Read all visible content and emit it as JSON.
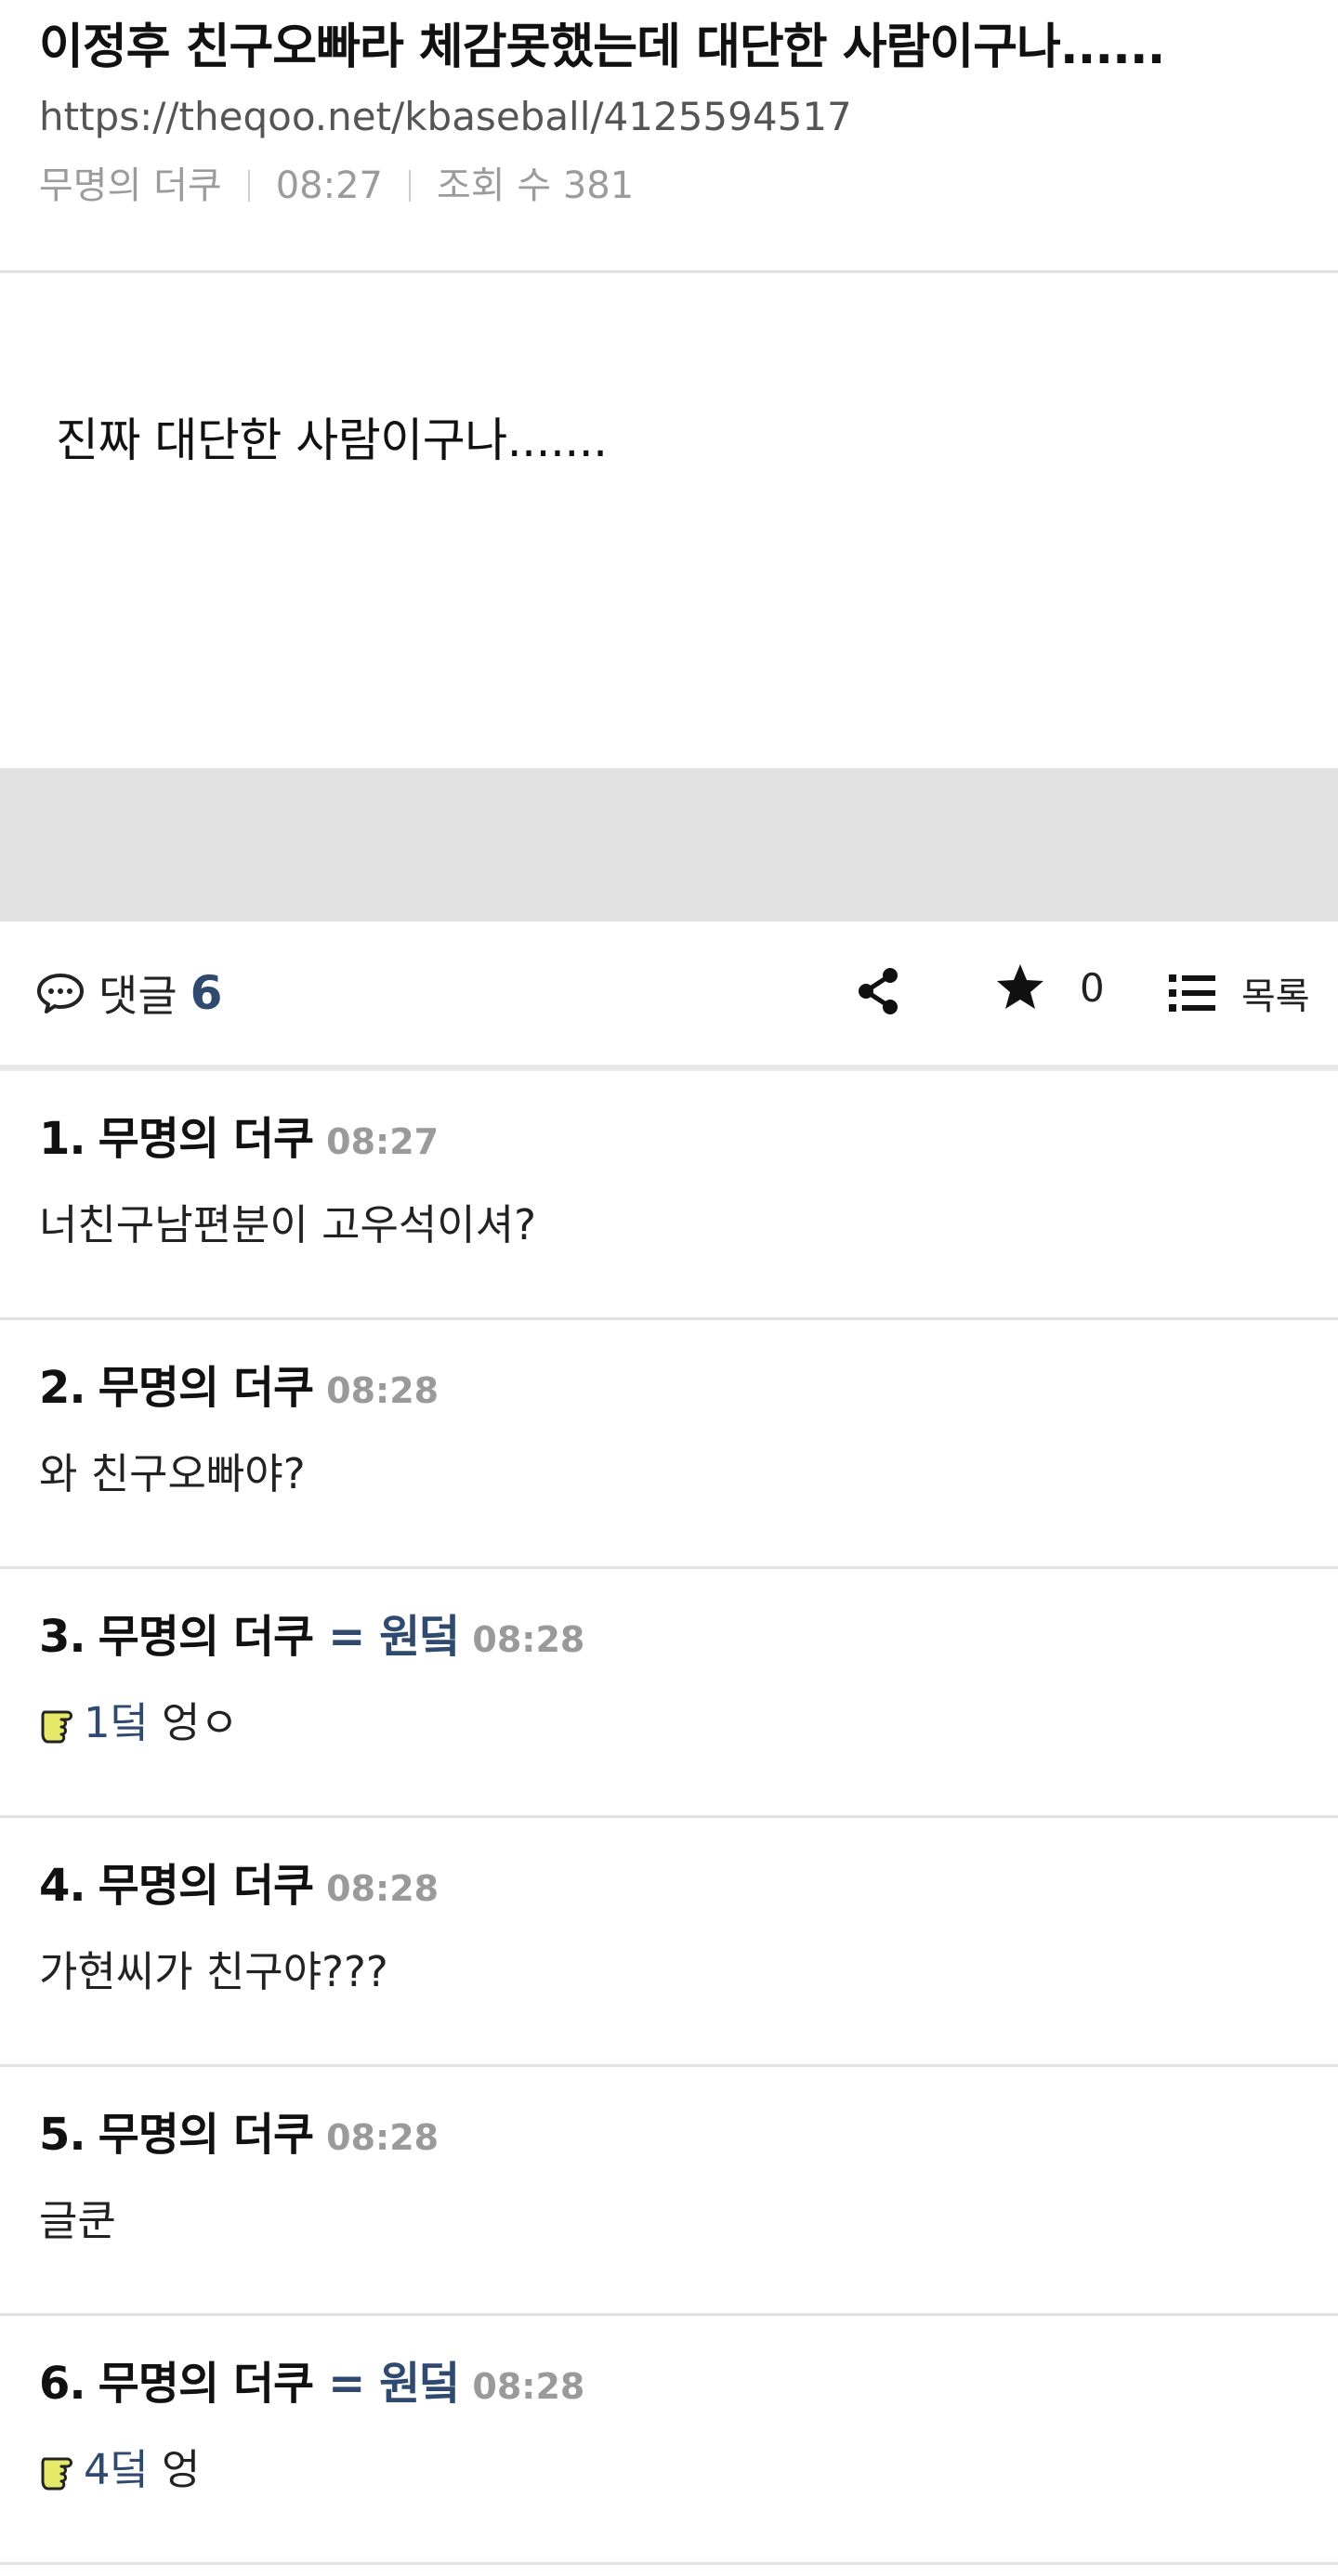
{
  "post": {
    "title": "이정후 친구오빠라 체감못했는데 대단한 사람이구나......",
    "url": "https://theqoo.net/kbaseball/4125594517",
    "author": "무명의 더쿠",
    "time": "08:27",
    "views": "조회 수 381",
    "body": "진짜 대단한 사람이구나......."
  },
  "toolbar": {
    "comments_label": "댓글",
    "comments_count": "6",
    "star_count": "0",
    "list_label": "목록",
    "icons": [
      "comment-icon",
      "share-icon",
      "star-icon",
      "list-icon"
    ]
  },
  "comments": [
    {
      "num": "1.",
      "author": "무명의 더쿠",
      "tag": "",
      "time": "08:27",
      "deok": "",
      "text": "너친구남편분이 고우석이셔?"
    },
    {
      "num": "2.",
      "author": "무명의 더쿠",
      "tag": "",
      "time": "08:28",
      "deok": "",
      "text": "와 친구오빠야?"
    },
    {
      "num": "3.",
      "author": "무명의 더쿠",
      "tag": "= 원덬",
      "time": "08:28",
      "deok": "1덬",
      "text": "엉ㅇ"
    },
    {
      "num": "4.",
      "author": "무명의 더쿠",
      "tag": "",
      "time": "08:28",
      "deok": "",
      "text": "가현씨가 친구야???"
    },
    {
      "num": "5.",
      "author": "무명의 더쿠",
      "tag": "",
      "time": "08:28",
      "deok": "",
      "text": "글쿤"
    },
    {
      "num": "6.",
      "author": "무명의 더쿠",
      "tag": "= 원덬",
      "time": "08:28",
      "deok": "4덬",
      "text": "엉"
    }
  ],
  "colors": {
    "accent": "#2f4a6e",
    "muted": "#9a9a9a",
    "band": "#e2e2e2",
    "hand": "#e6e86a"
  }
}
